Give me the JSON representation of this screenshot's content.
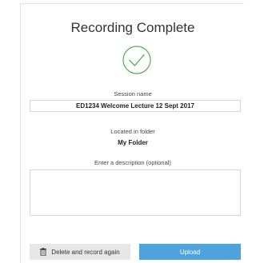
{
  "dialog": {
    "title": "Recording Complete",
    "status_icon": "checkmark-circle-icon",
    "accent_color": "#4caf50",
    "session": {
      "label": "Session name",
      "value": "ED1234 Welcome Lecture 12 Sept 2017"
    },
    "folder": {
      "label": "Located in folder",
      "value": "My Folder"
    },
    "description": {
      "label": "Enter a description (optional)",
      "value": ""
    },
    "buttons": {
      "delete_label": "Delete and record again",
      "delete_icon": "trash-icon",
      "upload_label": "Upload",
      "upload_color": "#4da3dd"
    }
  }
}
